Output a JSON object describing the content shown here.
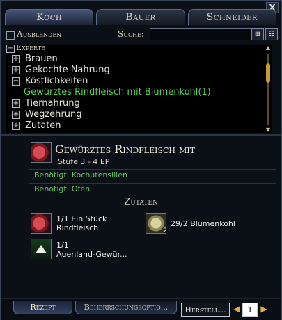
{
  "tabs": [
    "Koch",
    "Bauer",
    "Schneider"
  ],
  "close_label": "X",
  "toolbar": {
    "hide_label": "Ausblenden",
    "search_label": "Suche:",
    "search_value": "",
    "buttons": [
      "search-options-icon",
      "expand-collapse-icon"
    ]
  },
  "tree": {
    "expert_label": "Experte",
    "items": [
      {
        "label": "Brauen",
        "expanded": false
      },
      {
        "label": "Gekochte Nahrung",
        "expanded": false
      },
      {
        "label": "Köstlichkeiten",
        "expanded": true
      },
      {
        "label": "Gewürztes Rindfleisch mit Blumenkohl(1)",
        "selected": true
      },
      {
        "label": "Tiernahrung",
        "expanded": false
      },
      {
        "label": "Wegzehrung",
        "expanded": false
      },
      {
        "label": "Zutaten",
        "expanded": false
      }
    ]
  },
  "recipe": {
    "title": "Gewürztes Rindfleisch mit",
    "stufe": "Stufe 3 - 4 EP",
    "requirements": [
      "Benötigt: Kochutensilien",
      "Benötigt: Ofen"
    ],
    "ingredients_title": "Zutaten",
    "ingredients": [
      {
        "text_line1": "1/1 Ein Stück",
        "text_line2": "Rindfleisch",
        "icon": "meat-icon"
      },
      {
        "text_line1": "29/2 Blumenkohl",
        "text_line2": "",
        "icon": "cabbage-icon",
        "badge": "2"
      },
      {
        "text_line1": "1/1",
        "text_line2": "Auenland-Gewür...",
        "icon": "spice-icon"
      }
    ]
  },
  "bottom": {
    "tab1": "Rezept",
    "tab2": "Beherrschungsoptio...",
    "craft_button": "Herstell...",
    "count": "1",
    "left_arrow": "◀",
    "right_arrow": "▶"
  },
  "colors": {
    "selected_green": "#58d058",
    "requirement_green": "#63c266",
    "scroll_gold": "#c69c2e"
  }
}
